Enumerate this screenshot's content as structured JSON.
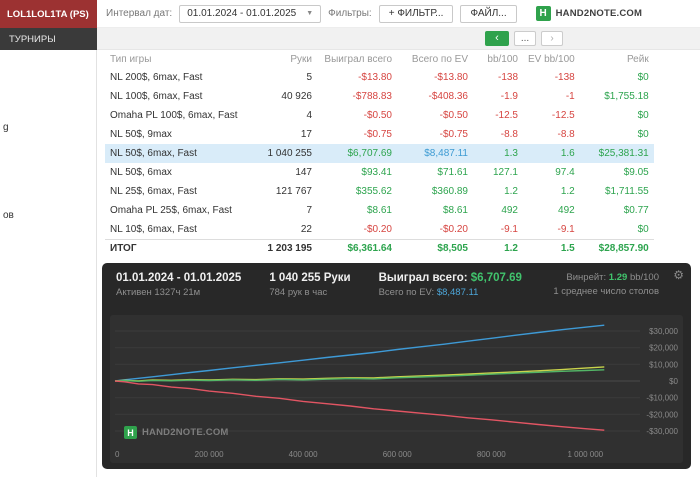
{
  "window": {
    "account_tab": "LOL1LOL1TA (PS)",
    "tournaments_tab": "ТУРНИРЫ"
  },
  "sidebar": {
    "items": [
      {
        "label": "g"
      },
      {
        "label": "ов"
      }
    ]
  },
  "toolbar": {
    "date_interval_label": "Интервал дат:",
    "date_range": "01.01.2024 - 01.01.2025",
    "filters_label": "Фильтры:",
    "filter_button": "+ ФИЛЬТР...",
    "file_button": "ФАЙЛ...",
    "brand": "HAND2NOTE.COM",
    "brand_initial": "H",
    "nav": {
      "back": "‹",
      "more": "...",
      "forward": "›"
    }
  },
  "table": {
    "columns": [
      "Тип игры",
      "Руки",
      "Выиграл всего",
      "Всего по EV",
      "bb/100",
      "EV bb/100",
      "Рейк"
    ],
    "rows": [
      {
        "type": "NL 200$, 6max, Fast",
        "hands": "5",
        "won": "-$13.80",
        "ev": "-$13.80",
        "bb": "-138",
        "evbb": "-138",
        "rake": "$0"
      },
      {
        "type": "NL 100$, 6max, Fast",
        "hands": "40 926",
        "won": "-$788.83",
        "ev": "-$408.36",
        "bb": "-1.9",
        "evbb": "-1",
        "rake": "$1,755.18"
      },
      {
        "type": "Omaha PL 100$, 6max, Fast",
        "hands": "4",
        "won": "-$0.50",
        "ev": "-$0.50",
        "bb": "-12.5",
        "evbb": "-12.5",
        "rake": "$0"
      },
      {
        "type": "NL 50$, 9max",
        "hands": "17",
        "won": "-$0.75",
        "ev": "-$0.75",
        "bb": "-8.8",
        "evbb": "-8.8",
        "rake": "$0"
      },
      {
        "type": "NL 50$, 6max, Fast",
        "hands": "1 040 255",
        "won": "$6,707.69",
        "ev": "$8,487.11",
        "bb": "1.3",
        "evbb": "1.6",
        "rake": "$25,381.31",
        "highlighted": true,
        "evBlue": true
      },
      {
        "type": "NL 50$, 6max",
        "hands": "147",
        "won": "$93.41",
        "ev": "$71.61",
        "bb": "127.1",
        "evbb": "97.4",
        "rake": "$9.05"
      },
      {
        "type": "NL 25$, 6max, Fast",
        "hands": "121 767",
        "won": "$355.62",
        "ev": "$360.89",
        "bb": "1.2",
        "evbb": "1.2",
        "rake": "$1,711.55"
      },
      {
        "type": "Omaha PL 25$, 6max, Fast",
        "hands": "7",
        "won": "$8.61",
        "ev": "$8.61",
        "bb": "492",
        "evbb": "492",
        "rake": "$0.77"
      },
      {
        "type": "NL 10$, 6max, Fast",
        "hands": "22",
        "won": "-$0.20",
        "ev": "-$0.20",
        "bb": "-9.1",
        "evbb": "-9.1",
        "rake": "$0"
      }
    ],
    "total": {
      "type": "ИТОГ",
      "hands": "1 203 195",
      "won": "$6,361.64",
      "ev": "$8,505",
      "bb": "1.2",
      "evbb": "1.5",
      "rake": "$28,857.90"
    }
  },
  "panel": {
    "date_range": "01.01.2024 - 01.01.2025",
    "active_time": "Активен 1327ч 21м",
    "hands": "1 040 255 Руки",
    "hands_per_hour": "784 рук в час",
    "won_label": "Выиграл всего:",
    "won_value": "$6,707.69",
    "ev_label": "Всего по EV:",
    "ev_value": "$8,487.11",
    "winrate_label": "Винрейт:",
    "winrate_value": "1.29",
    "winrate_unit": "bb/100",
    "tables_avg": "1 среднее число столов",
    "brand": "HAND2NOTE.COM",
    "brand_initial": "H"
  },
  "colors": {
    "accent_green": "#2fa24c",
    "positive": "#2da44e",
    "negative": "#d64541",
    "ev_blue": "#3d9bd3",
    "highlight_row": "#d9ecf9",
    "panel_bg": "#282828",
    "account_tab_bg": "#9c3232"
  },
  "chart_data": {
    "type": "line",
    "title": "",
    "xlabel": "",
    "ylabel": "",
    "grid": true,
    "legend": false,
    "x_axis": {
      "max_hands": 1095000,
      "ticks": [
        {
          "v": 0,
          "label": "0"
        },
        {
          "v": 200000,
          "label": "200 000"
        },
        {
          "v": 400000,
          "label": "400 000"
        },
        {
          "v": 600000,
          "label": "600 000"
        },
        {
          "v": 800000,
          "label": "800 000"
        },
        {
          "v": 1000000,
          "label": "1 000 000"
        }
      ]
    },
    "y_axis": {
      "min": -36000,
      "max": 36000,
      "ticks": [
        {
          "v": 30000,
          "label": "$30,000"
        },
        {
          "v": 20000,
          "label": "$20,000"
        },
        {
          "v": 10000,
          "label": "$10,000"
        },
        {
          "v": 0,
          "label": "$0"
        },
        {
          "v": -10000,
          "label": "-$10,000"
        },
        {
          "v": -20000,
          "label": "-$20,000"
        },
        {
          "v": -30000,
          "label": "-$30,000"
        }
      ]
    },
    "x": [
      0,
      20000,
      50000,
      80000,
      120000,
      160000,
      200000,
      250000,
      300000,
      350000,
      400000,
      450000,
      500000,
      550000,
      600000,
      650000,
      700000,
      750000,
      800000,
      850000,
      900000,
      950000,
      1000000,
      1040255
    ],
    "series": [
      {
        "name": "showdown-winnings",
        "color": "#3e9ad6",
        "values": [
          0,
          700,
          1600,
          2500,
          3800,
          5100,
          6300,
          7900,
          9400,
          10900,
          12500,
          14100,
          15600,
          17100,
          18900,
          20500,
          22100,
          23900,
          25600,
          27400,
          29100,
          30800,
          32300,
          33500
        ]
      },
      {
        "name": "ev-winnings",
        "color": "#c9d44c",
        "values": [
          0,
          420,
          60,
          600,
          420,
          820,
          620,
          1050,
          850,
          1350,
          1150,
          1650,
          1950,
          1850,
          2550,
          3050,
          3550,
          4150,
          4850,
          5450,
          6150,
          6850,
          7750,
          8487
        ]
      },
      {
        "name": "winnings",
        "color": "#53b567",
        "values": [
          0,
          250,
          -150,
          350,
          150,
          550,
          250,
          700,
          450,
          950,
          650,
          1100,
          1450,
          1250,
          1900,
          2400,
          2900,
          3400,
          4100,
          4700,
          5200,
          5800,
          6300,
          6708
        ]
      },
      {
        "name": "non-showdown-winnings",
        "color": "#e25563",
        "values": [
          0,
          -450,
          -1750,
          -2150,
          -3650,
          -4550,
          -6050,
          -7400,
          -9150,
          -10350,
          -12250,
          -13600,
          -15000,
          -16700,
          -18000,
          -19300,
          -20600,
          -22100,
          -23300,
          -24700,
          -26100,
          -27400,
          -28600,
          -29500
        ]
      }
    ]
  }
}
